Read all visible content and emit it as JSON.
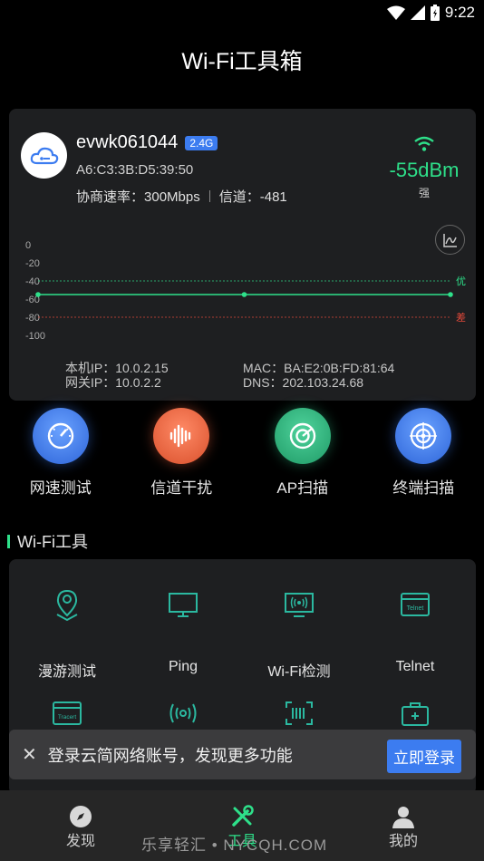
{
  "status": {
    "time": "9:22"
  },
  "title": "Wi-Fi工具箱",
  "wifi": {
    "ssid": "evwk061044",
    "band": "2.4G",
    "mac": "A6:C3:3B:D5:39:50",
    "rate_label": "协商速率：",
    "rate": "300Mbps",
    "channel_label": "信道：",
    "channel": "-481",
    "signal": "-55dBm",
    "signal_quality": "强",
    "local_ip": "本机IP：10.0.2.15",
    "gateway_ip": "网关IP：10.0.2.2",
    "mac_addr": "MAC：BA:E2:0B:FD:81:64",
    "dns": "DNS：202.103.24.68"
  },
  "chart_data": {
    "type": "line",
    "y_ticks": [
      "0",
      "-20",
      "-40",
      "-60",
      "-80",
      "-100"
    ],
    "ylim": [
      -100,
      0
    ],
    "series": [
      {
        "values": [
          -55,
          -55,
          -55
        ]
      }
    ],
    "reference_lines": [
      {
        "label": "优",
        "value": -40,
        "color": "#2ee08a"
      },
      {
        "label": "差",
        "value": -80,
        "color": "#e84a3b"
      }
    ]
  },
  "quick_actions": [
    {
      "label": "网速测试",
      "color": "#3c7cf0",
      "icon": "speedometer-icon"
    },
    {
      "label": "信道干扰",
      "color": "#e8603c",
      "icon": "waveform-icon"
    },
    {
      "label": "AP扫描",
      "color": "#2bb07a",
      "icon": "radar-icon"
    },
    {
      "label": "终端扫描",
      "color": "#3c7cf0",
      "icon": "target-icon"
    }
  ],
  "section": {
    "title": "Wi-Fi工具"
  },
  "tools": [
    {
      "label": "漫游测试",
      "icon": "location-pin-icon"
    },
    {
      "label": "Ping",
      "icon": "monitor-icon"
    },
    {
      "label": "Wi-Fi检测",
      "icon": "wifi-detect-icon"
    },
    {
      "label": "Telnet",
      "icon": "telnet-icon",
      "icon_text": "Telnet"
    },
    {
      "label": "",
      "icon": "tracert-icon",
      "icon_text": "Tracert"
    },
    {
      "label": "",
      "icon": "broadcast-icon"
    },
    {
      "label": "",
      "icon": "barcode-scan-icon"
    },
    {
      "label": "",
      "icon": "toolbox-icon"
    }
  ],
  "toast": {
    "message": "登录云简网络账号，发现更多功能",
    "button": "立即登录"
  },
  "tabs": [
    {
      "label": "发现"
    },
    {
      "label": "工具"
    },
    {
      "label": "我的"
    }
  ],
  "watermark": "乐享轻汇 • NYCQH.COM",
  "colors": {
    "accent": "#2ee08a",
    "primary": "#3c7cf0",
    "card": "#1e1f21"
  }
}
